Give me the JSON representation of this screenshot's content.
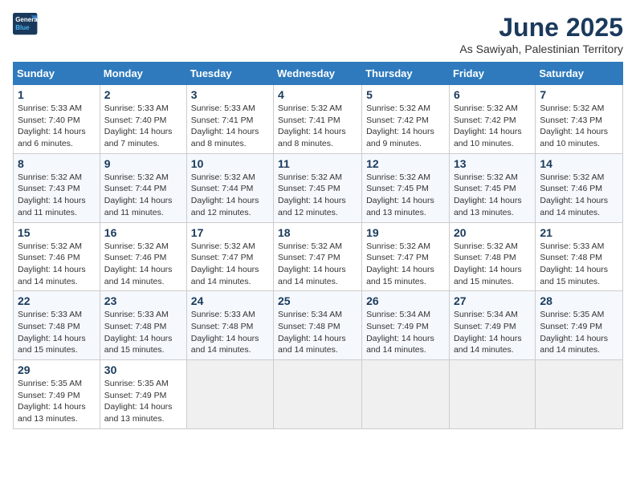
{
  "header": {
    "logo_line1": "General",
    "logo_line2": "Blue",
    "month": "June 2025",
    "location": "As Sawiyah, Palestinian Territory"
  },
  "weekdays": [
    "Sunday",
    "Monday",
    "Tuesday",
    "Wednesday",
    "Thursday",
    "Friday",
    "Saturday"
  ],
  "weeks": [
    [
      {
        "day": "1",
        "sunrise": "5:33 AM",
        "sunset": "7:40 PM",
        "daylight": "14 hours and 6 minutes."
      },
      {
        "day": "2",
        "sunrise": "5:33 AM",
        "sunset": "7:40 PM",
        "daylight": "14 hours and 7 minutes."
      },
      {
        "day": "3",
        "sunrise": "5:33 AM",
        "sunset": "7:41 PM",
        "daylight": "14 hours and 8 minutes."
      },
      {
        "day": "4",
        "sunrise": "5:32 AM",
        "sunset": "7:41 PM",
        "daylight": "14 hours and 8 minutes."
      },
      {
        "day": "5",
        "sunrise": "5:32 AM",
        "sunset": "7:42 PM",
        "daylight": "14 hours and 9 minutes."
      },
      {
        "day": "6",
        "sunrise": "5:32 AM",
        "sunset": "7:42 PM",
        "daylight": "14 hours and 10 minutes."
      },
      {
        "day": "7",
        "sunrise": "5:32 AM",
        "sunset": "7:43 PM",
        "daylight": "14 hours and 10 minutes."
      }
    ],
    [
      {
        "day": "8",
        "sunrise": "5:32 AM",
        "sunset": "7:43 PM",
        "daylight": "14 hours and 11 minutes."
      },
      {
        "day": "9",
        "sunrise": "5:32 AM",
        "sunset": "7:44 PM",
        "daylight": "14 hours and 11 minutes."
      },
      {
        "day": "10",
        "sunrise": "5:32 AM",
        "sunset": "7:44 PM",
        "daylight": "14 hours and 12 minutes."
      },
      {
        "day": "11",
        "sunrise": "5:32 AM",
        "sunset": "7:45 PM",
        "daylight": "14 hours and 12 minutes."
      },
      {
        "day": "12",
        "sunrise": "5:32 AM",
        "sunset": "7:45 PM",
        "daylight": "14 hours and 13 minutes."
      },
      {
        "day": "13",
        "sunrise": "5:32 AM",
        "sunset": "7:45 PM",
        "daylight": "14 hours and 13 minutes."
      },
      {
        "day": "14",
        "sunrise": "5:32 AM",
        "sunset": "7:46 PM",
        "daylight": "14 hours and 14 minutes."
      }
    ],
    [
      {
        "day": "15",
        "sunrise": "5:32 AM",
        "sunset": "7:46 PM",
        "daylight": "14 hours and 14 minutes."
      },
      {
        "day": "16",
        "sunrise": "5:32 AM",
        "sunset": "7:46 PM",
        "daylight": "14 hours and 14 minutes."
      },
      {
        "day": "17",
        "sunrise": "5:32 AM",
        "sunset": "7:47 PM",
        "daylight": "14 hours and 14 minutes."
      },
      {
        "day": "18",
        "sunrise": "5:32 AM",
        "sunset": "7:47 PM",
        "daylight": "14 hours and 14 minutes."
      },
      {
        "day": "19",
        "sunrise": "5:32 AM",
        "sunset": "7:47 PM",
        "daylight": "14 hours and 15 minutes."
      },
      {
        "day": "20",
        "sunrise": "5:32 AM",
        "sunset": "7:48 PM",
        "daylight": "14 hours and 15 minutes."
      },
      {
        "day": "21",
        "sunrise": "5:33 AM",
        "sunset": "7:48 PM",
        "daylight": "14 hours and 15 minutes."
      }
    ],
    [
      {
        "day": "22",
        "sunrise": "5:33 AM",
        "sunset": "7:48 PM",
        "daylight": "14 hours and 15 minutes."
      },
      {
        "day": "23",
        "sunrise": "5:33 AM",
        "sunset": "7:48 PM",
        "daylight": "14 hours and 15 minutes."
      },
      {
        "day": "24",
        "sunrise": "5:33 AM",
        "sunset": "7:48 PM",
        "daylight": "14 hours and 14 minutes."
      },
      {
        "day": "25",
        "sunrise": "5:34 AM",
        "sunset": "7:48 PM",
        "daylight": "14 hours and 14 minutes."
      },
      {
        "day": "26",
        "sunrise": "5:34 AM",
        "sunset": "7:49 PM",
        "daylight": "14 hours and 14 minutes."
      },
      {
        "day": "27",
        "sunrise": "5:34 AM",
        "sunset": "7:49 PM",
        "daylight": "14 hours and 14 minutes."
      },
      {
        "day": "28",
        "sunrise": "5:35 AM",
        "sunset": "7:49 PM",
        "daylight": "14 hours and 14 minutes."
      }
    ],
    [
      {
        "day": "29",
        "sunrise": "5:35 AM",
        "sunset": "7:49 PM",
        "daylight": "14 hours and 13 minutes."
      },
      {
        "day": "30",
        "sunrise": "5:35 AM",
        "sunset": "7:49 PM",
        "daylight": "14 hours and 13 minutes."
      },
      {
        "day": "",
        "sunrise": "",
        "sunset": "",
        "daylight": ""
      },
      {
        "day": "",
        "sunrise": "",
        "sunset": "",
        "daylight": ""
      },
      {
        "day": "",
        "sunrise": "",
        "sunset": "",
        "daylight": ""
      },
      {
        "day": "",
        "sunrise": "",
        "sunset": "",
        "daylight": ""
      },
      {
        "day": "",
        "sunrise": "",
        "sunset": "",
        "daylight": ""
      }
    ]
  ],
  "labels": {
    "sunrise": "Sunrise:",
    "sunset": "Sunset:",
    "daylight": "Daylight:"
  }
}
